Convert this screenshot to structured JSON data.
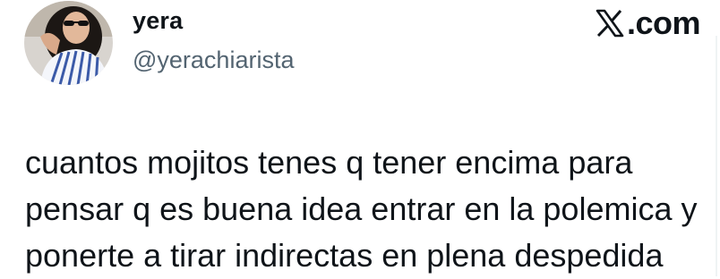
{
  "author": {
    "display_name": "yera",
    "handle": "@yerachiarista",
    "avatar_icon": "profile-photo"
  },
  "brand": {
    "label": ".com",
    "icon": "x-logo-icon"
  },
  "tweet": {
    "lines": [
      "cuantos mojitos tenes q tener encima para",
      "pensar q es buena idea entrar en la polemica y",
      "ponerte a tirar indirectas en plena despedida"
    ]
  },
  "colors": {
    "text": "#0f1419",
    "secondary": "#536471",
    "background": "#ffffff"
  }
}
